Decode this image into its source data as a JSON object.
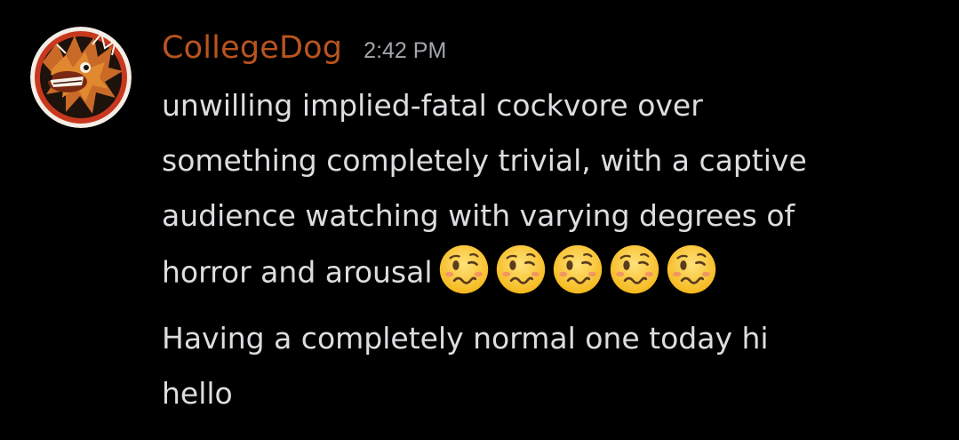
{
  "message": {
    "username": "CollegeDog",
    "timestamp": "2:42 PM",
    "lines": [
      "unwilling implied-fatal cockvore over",
      "something completely trivial, with a captive",
      "audience watching with varying degrees of",
      "horror and arousal"
    ],
    "emoji": {
      "name": "woozy-face-icon",
      "count": 5
    },
    "second_lines": [
      "Having a completely normal one today hi",
      "hello"
    ]
  },
  "colors": {
    "background": "#000000",
    "username": "#b9541f",
    "timestamp": "#a3a6ad",
    "text": "#dcdde0"
  }
}
